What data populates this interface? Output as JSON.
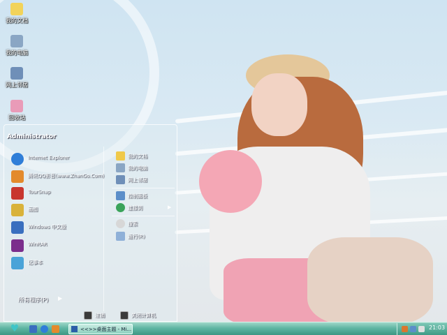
{
  "desktop_icons": [
    {
      "label": "我的文档",
      "icon": "folder-documents-icon",
      "color": "#f2d35a"
    },
    {
      "label": "我的电脑",
      "icon": "computer-icon",
      "color": "#8aa6c4"
    },
    {
      "label": "网上邻居",
      "icon": "network-icon",
      "color": "#6f8fb8"
    },
    {
      "label": "回收站",
      "icon": "recycle-bin-icon",
      "color": "#e99bb8"
    }
  ],
  "start_menu": {
    "user": "Administrator",
    "left_items": [
      {
        "label": "Internet Explorer",
        "icon": "internet-explorer-icon",
        "color": "#2f7ed8"
      },
      {
        "label": "腾讯QQ影音(www.ZhanGo.Com)",
        "icon": "media-player-icon",
        "color": "#e38a2c"
      },
      {
        "label": "TourSnap",
        "icon": "toursnap-icon",
        "color": "#c8362f"
      },
      {
        "label": "画图",
        "icon": "paint-icon",
        "color": "#d9b23a"
      },
      {
        "label": "Windows 中文版",
        "icon": "monitor-icon",
        "color": "#3a6fbf"
      },
      {
        "label": "WinRAR",
        "icon": "winrar-icon",
        "color": "#7b2d8c"
      },
      {
        "label": "记事本",
        "icon": "notepad-icon",
        "color": "#4aa3d8"
      }
    ],
    "all_programs": "所有程序(P)",
    "right_items": [
      {
        "label": "我的文档",
        "icon": "folder-icon",
        "color": "#f0c94a"
      },
      {
        "label": "我的电脑",
        "icon": "computer-icon",
        "color": "#8aa6c4"
      },
      {
        "label": "网上邻居",
        "icon": "network-icon",
        "color": "#6f8fb8"
      },
      {
        "label": "控制面板",
        "icon": "control-panel-icon",
        "color": "#5b8ec9"
      },
      {
        "label": "连接到",
        "icon": "connect-icon",
        "color": "#3aa35a"
      },
      {
        "label": "搜索",
        "icon": "search-icon",
        "color": "#d7d7d7"
      },
      {
        "label": "运行(R)",
        "icon": "run-icon",
        "color": "#8fb0d8"
      }
    ],
    "logoff": "注销",
    "shutdown": "关闭计算机"
  },
  "taskbar": {
    "task_button": "<<>>桌面主题 - Mi...",
    "clock": "21:03"
  }
}
